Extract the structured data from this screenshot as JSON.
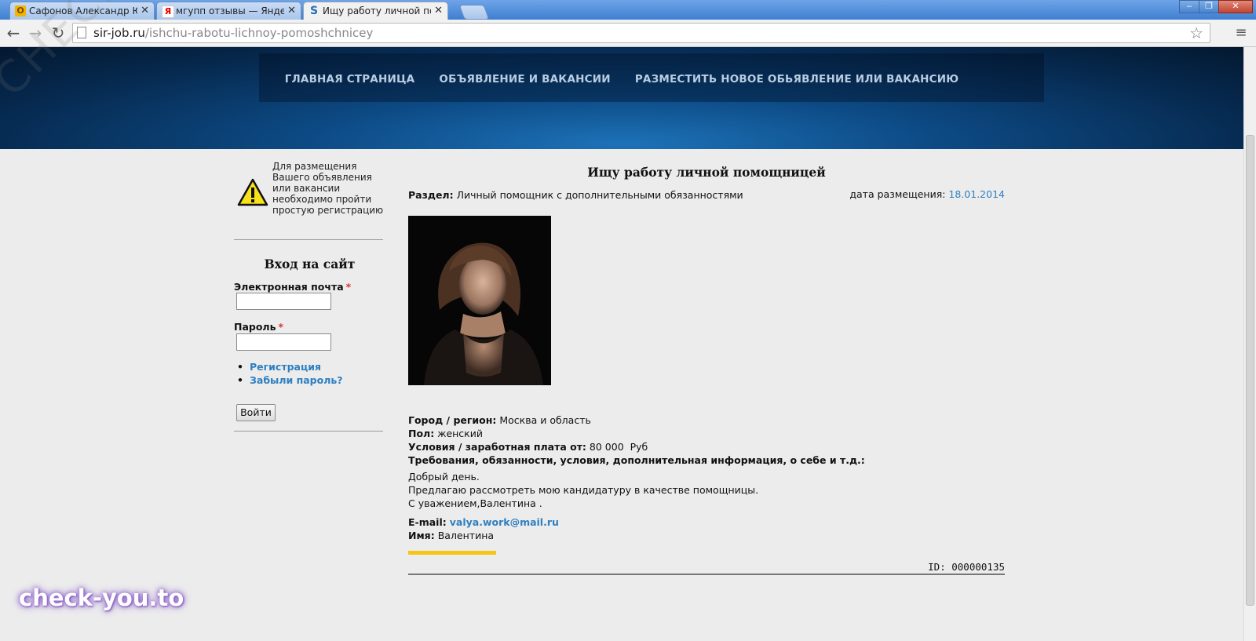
{
  "browser": {
    "tabs": [
      {
        "favicon": "О",
        "title": "Сафонов Александр Юри",
        "close": "✕"
      },
      {
        "favicon": "Я",
        "title": "мгупп отзывы — Яндекс",
        "close": "✕"
      },
      {
        "favicon": "S",
        "title": "Ищу работу личной пом",
        "close": "✕"
      }
    ],
    "window_controls": {
      "minimize": "‒",
      "restore": "❐",
      "close": "✕"
    },
    "url_host": "sir-job.ru",
    "url_path": "/ishchu-rabotu-lichnoy-pomoshchnicey",
    "icons": {
      "back": "back-arrow-icon",
      "forward": "forward-arrow-icon",
      "reload": "reload-icon",
      "star": "bookmark-star-icon",
      "menu": "chrome-menu-icon"
    }
  },
  "nav": {
    "items": [
      "ГЛАВНАЯ СТРАНИЦА",
      "ОБЪЯВЛЕНИЕ И ВАКАНСИИ",
      "РАЗМЕСТИТЬ НОВОЕ ОБЬЯВЛЕНИЕ ИЛИ ВАКАНСИЮ"
    ]
  },
  "sidebar": {
    "notice": "Для размещения Вашего объявления или вакансии необходимо пройти простую регистрацию",
    "login_title": "Вход на сайт",
    "email_label": "Электронная почта",
    "password_label": "Пароль",
    "required_mark": "*",
    "links": [
      "Регистрация",
      "Забыли пароль?"
    ],
    "login_button": "Войти"
  },
  "ad": {
    "title": "Ищу работу личной помощницей",
    "section_label": "Раздел:",
    "section_value": "Личный помощник с дополнительными обязанностями",
    "date_label": "дата размещения:",
    "date_value": "18.01.2014",
    "city_label": "Город / регион:",
    "city_value": "Москва и область",
    "gender_label": "Пол:",
    "gender_value": "женский",
    "salary_label": "Условия / заработная плата от:",
    "salary_value": "80 000  Руб",
    "requirements_label": "Требования, обязанности, условия, дополнительная информация, о себе и т.д.:",
    "message_lines": [
      "Добрый день.",
      "Предлагаю рассмотреть мою кандидатуру в качестве помощницы.",
      "С уважением,Валентина ."
    ],
    "email_label": "E-mail:",
    "email_value": "valya.work@mail.ru",
    "name_label": "Имя:",
    "name_value": "Валентина",
    "id_text": "ID: 000000135"
  },
  "watermarks": {
    "diagonal": "CHECK-YOU.ME",
    "logo": "check-you.to"
  },
  "colors": {
    "link": "#2e7fc1",
    "accent_bar": "#f5c518",
    "header": "#0d4b86",
    "required": "#d33"
  }
}
